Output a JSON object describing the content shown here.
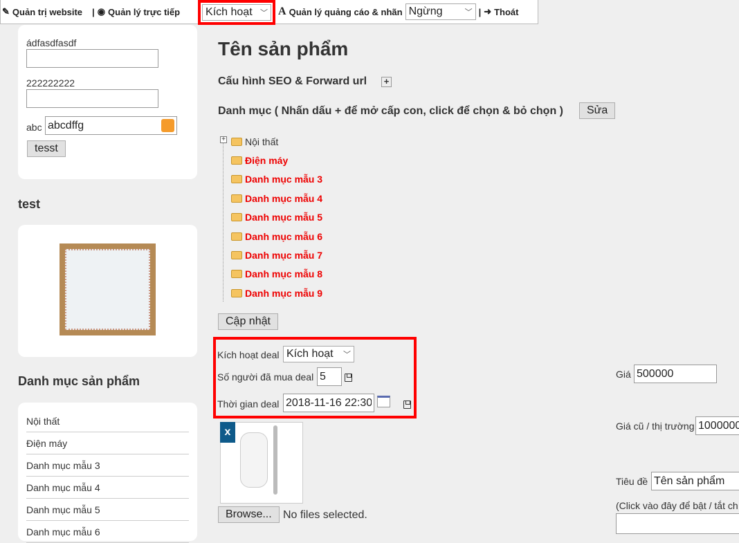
{
  "topbar": {
    "admin": "Quản trị website",
    "live": "Quản lý trực tiếp",
    "live_status": "Kích hoạt",
    "ads": "Quản lý quảng cáo & nhãn",
    "ads_status": "Ngừng",
    "logout": "Thoát"
  },
  "sidebar": {
    "form": {
      "label1": "ádfasdfasdf",
      "label2": "222222222",
      "label3": "abc",
      "value3": "abcdffg",
      "button": "tesst"
    },
    "test_title": "test",
    "category_title": "Danh mục sản phẩm",
    "categories": [
      "Nội thất",
      "Điện máy",
      "Danh mục mẫu 3",
      "Danh mục mẫu 4",
      "Danh mục mẫu 5",
      "Danh mục mẫu 6"
    ]
  },
  "main": {
    "title": "Tên sản phẩm",
    "seo": "Cấu hình SEO & Forward url",
    "category_heading": "Danh mục ( Nhấn dấu + để mở cấp con, click để chọn & bỏ chọn )",
    "edit_button": "Sửa",
    "tree": [
      {
        "label": "Nội thất",
        "selected": false
      },
      {
        "label": "Điện máy",
        "selected": true
      },
      {
        "label": "Danh mục mẫu 3",
        "selected": true
      },
      {
        "label": "Danh mục mẫu 4",
        "selected": true
      },
      {
        "label": "Danh mục mẫu 5",
        "selected": true
      },
      {
        "label": "Danh mục mẫu 6",
        "selected": true
      },
      {
        "label": "Danh mục mẫu 7",
        "selected": true
      },
      {
        "label": "Danh mục mẫu 8",
        "selected": true
      },
      {
        "label": "Danh mục mẫu 9",
        "selected": true
      }
    ],
    "update_button": "Cập nhật",
    "deal": {
      "active_label": "Kích hoạt deal",
      "active_value": "Kích hoạt",
      "buyers_label": "Số người đã mua deal",
      "buyers_value": "5",
      "time_label": "Thời gian deal",
      "time_value": "2018-11-16 22:30"
    },
    "image_remove": "x",
    "browse": "Browse...",
    "no_files": "No files selected.",
    "price_label": "Giá",
    "price_value": "500000",
    "old_price_label": "Giá cũ / thị trường",
    "old_price_value": "1000000",
    "title_label": "Tiêu đề",
    "title_value": "Tên sản phẩm",
    "toggle_hint": "(Click vào đây để bật / tắt ch"
  }
}
